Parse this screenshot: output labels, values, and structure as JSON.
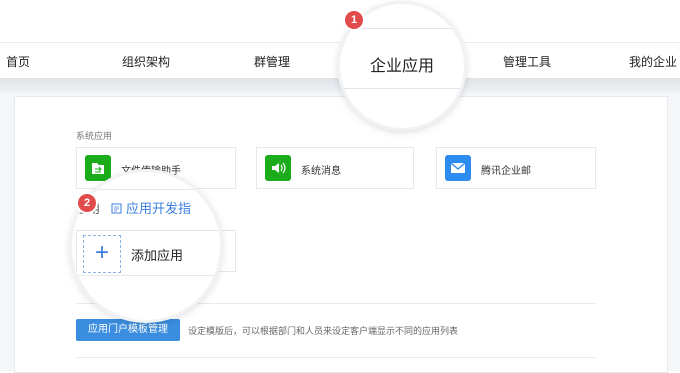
{
  "nav": {
    "items": [
      "首页",
      "组织架构",
      "群管理",
      "管理工具",
      "我的企业"
    ],
    "highlighted": "企业应用"
  },
  "system_apps": {
    "title": "系统应用",
    "apps": [
      {
        "label": "文件传输助手",
        "icon": "file-transfer-icon",
        "color": "#1aad19"
      },
      {
        "label": "系统消息",
        "icon": "speaker-icon",
        "color": "#1aad19"
      },
      {
        "label": "腾讯企业邮",
        "icon": "mail-icon",
        "color": "#2d8cf0"
      }
    ]
  },
  "custom_apps": {
    "title": "应用",
    "dev_link": "应用开发指",
    "add_label": "添加应用",
    "add_icon": "plus-icon"
  },
  "portal": {
    "button_label": "应用门户模板管理",
    "hint": "设定模版后，可以根据部门和人员来设定客户端显示不同的应用列表"
  },
  "badges": [
    "1",
    "2"
  ],
  "accent": "#3b8de0",
  "badge_color": "#e14b4b"
}
